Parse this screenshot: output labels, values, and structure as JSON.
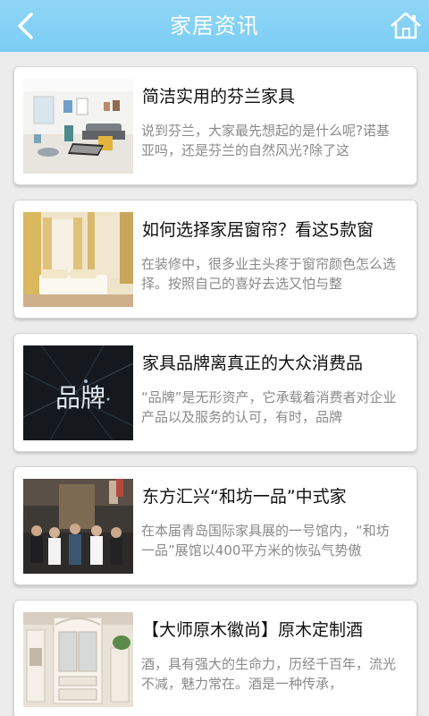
{
  "header": {
    "title": "家居资讯",
    "back_icon": "back-chevron-icon",
    "home_icon": "home-icon",
    "bar_color": "#86d2f5"
  },
  "articles": [
    {
      "title": "简洁实用的芬兰家具",
      "desc": "说到芬兰，大家最先想起的是什么呢?诺基亚吗，还是芬兰的自然风光?除了这",
      "image": "bright-living-room-photo"
    },
    {
      "title": "如何选择家居窗帘？看这5款窗",
      "desc": "在装修中，很多业主头疼于窗帘颜色怎么选择。按照自己的喜好去选又怕与整",
      "image": "bedroom-curtains-photo"
    },
    {
      "title": "家具品牌离真正的大众消费品",
      "desc": "“品牌”是无形资产，它承载着消费者对企业产品以及服务的认可，有时，品牌",
      "image": "dark-brand-graphic",
      "image_text": "品牌"
    },
    {
      "title": "东方汇兴“和坊一品”中式家",
      "desc": "在本届青岛国际家具展的一号馆内，“和坊一品”展馆以400平方米的恢弘气势傲",
      "image": "furniture-expo-crowd-photo"
    },
    {
      "title": "【大师原木徽尚】原木定制酒",
      "desc": "酒，具有强大的生命力，历经千百年，流光不减，魅力常在。酒是一种传承，",
      "image": "wine-cabinet-photo"
    }
  ]
}
